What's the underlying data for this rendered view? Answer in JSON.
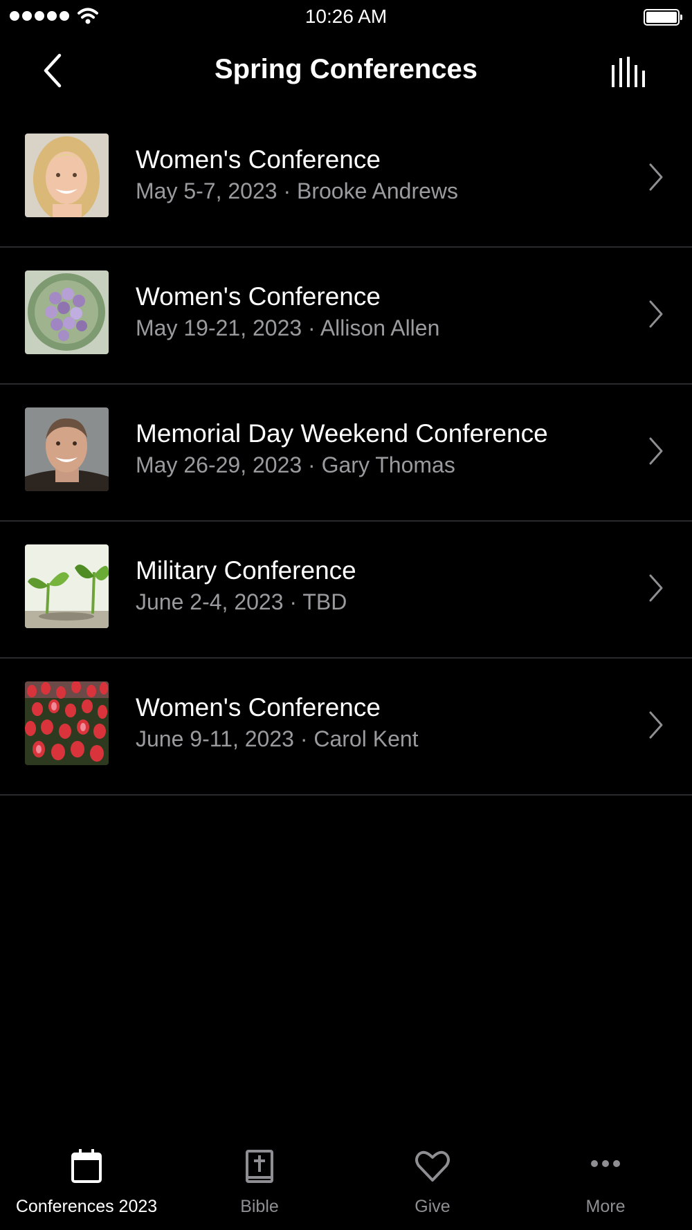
{
  "status_bar": {
    "time": "10:26 AM"
  },
  "header": {
    "title": "Spring Conferences",
    "back_icon": "chevron-left-icon",
    "action_icon": "audio-bars-icon"
  },
  "conferences": [
    {
      "title": "Women's Conference",
      "subtitle": "May 5-7, 2023 · Brooke Andrews",
      "thumbnail": "portrait-blonde-woman"
    },
    {
      "title": "Women's Conference",
      "subtitle": "May 19-21, 2023 · Allison Allen",
      "thumbnail": "purple-tulip-bouquet"
    },
    {
      "title": "Memorial Day Weekend Conference",
      "subtitle": "May 26-29, 2023 · Gary Thomas",
      "thumbnail": "portrait-smiling-man"
    },
    {
      "title": "Military Conference",
      "subtitle": "June 2-4, 2023 · TBD",
      "thumbnail": "green-seedlings"
    },
    {
      "title": "Women's Conference",
      "subtitle": "June 9-11, 2023 · Carol Kent",
      "thumbnail": "red-tulip-field"
    }
  ],
  "tab_bar": {
    "tabs": [
      {
        "label": "Conferences 2023",
        "icon": "calendar-icon",
        "active": true
      },
      {
        "label": "Bible",
        "icon": "bible-icon",
        "active": false
      },
      {
        "label": "Give",
        "icon": "heart-icon",
        "active": false
      },
      {
        "label": "More",
        "icon": "more-dots-icon",
        "active": false
      }
    ]
  },
  "colors": {
    "background": "#000000",
    "text_primary": "#ffffff",
    "text_secondary": "#9b9b9f",
    "separator": "#2a2a2c",
    "tab_inactive": "#8e8e93"
  }
}
